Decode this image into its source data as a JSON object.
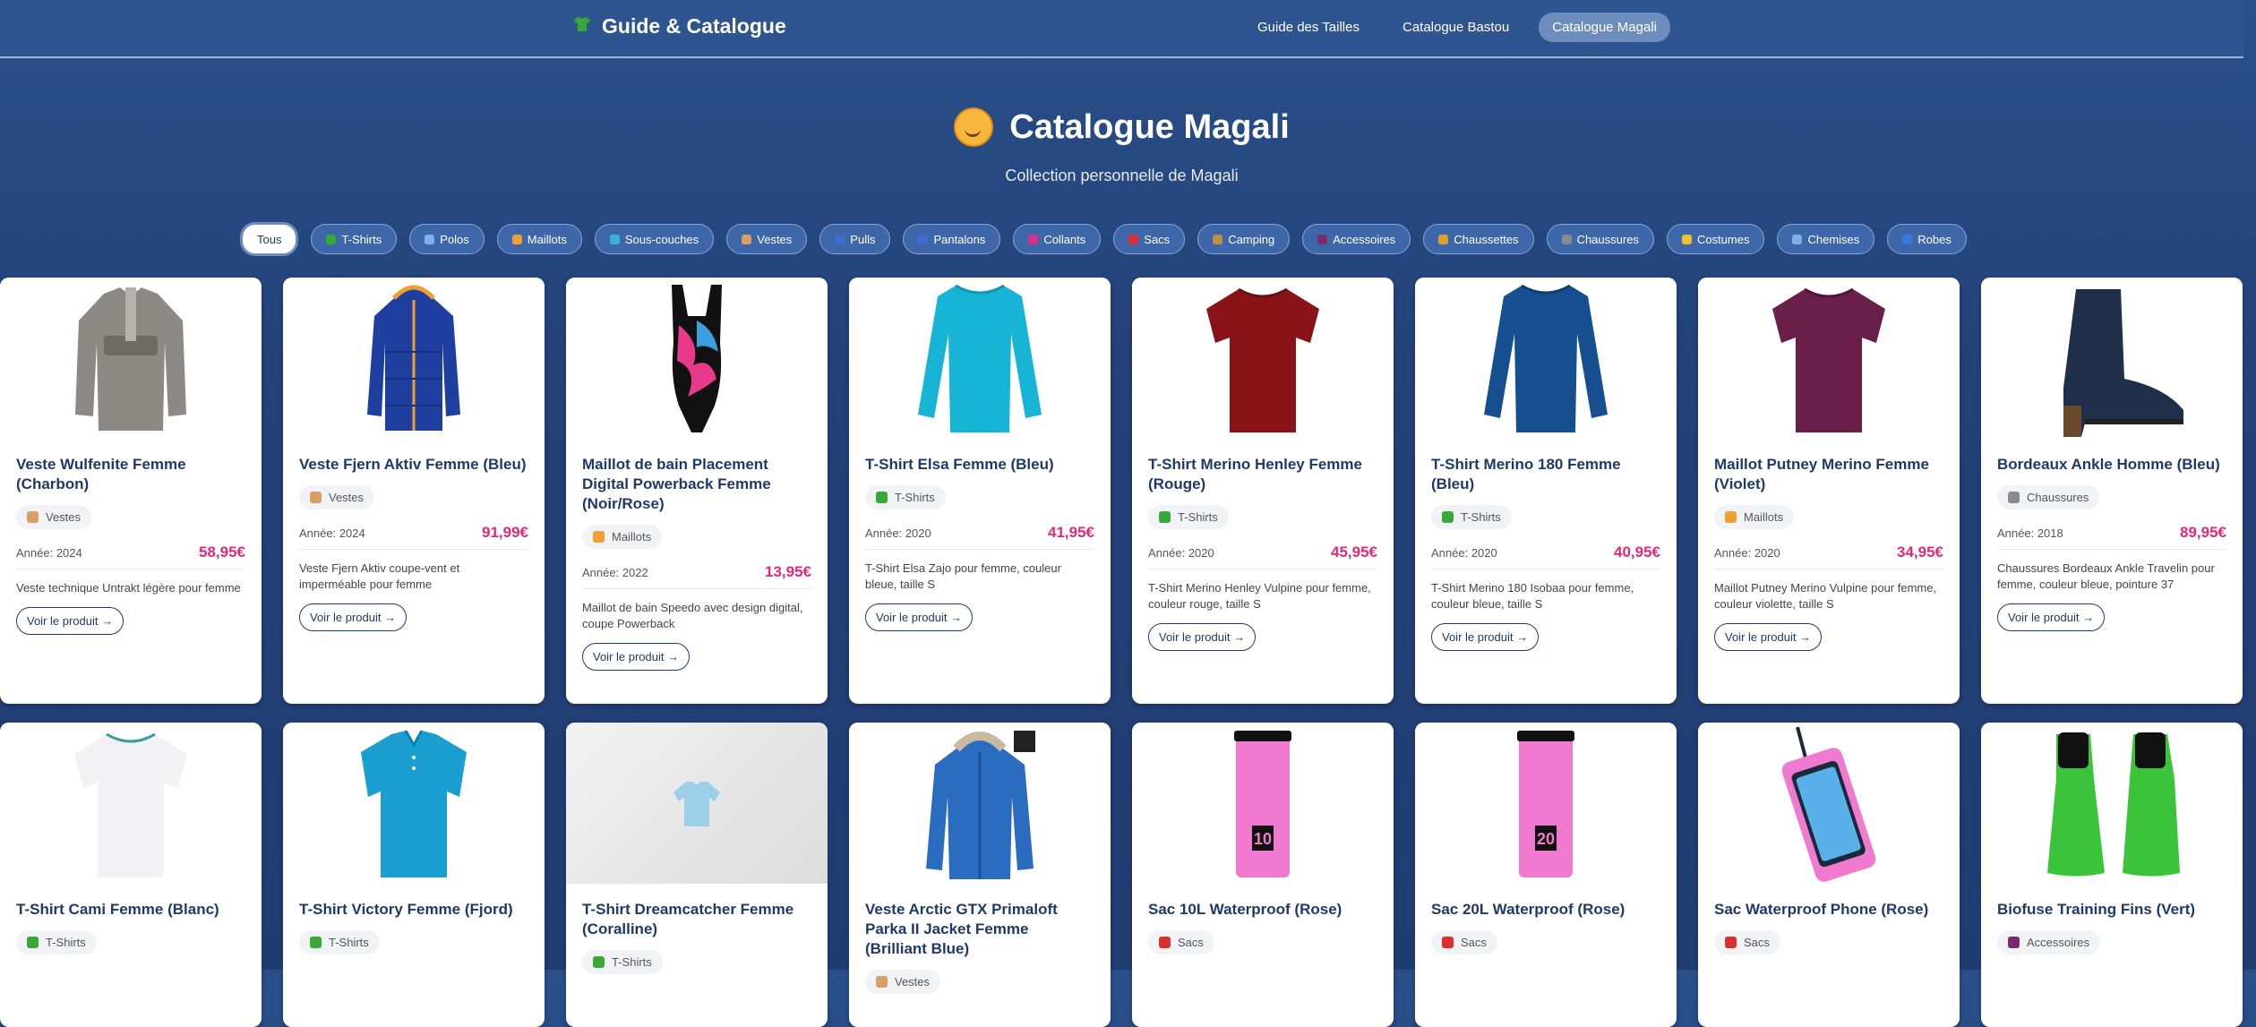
{
  "header": {
    "brand": "Guide & Catalogue",
    "nav": [
      {
        "label": "Guide des Tailles",
        "active": false
      },
      {
        "label": "Catalogue Bastou",
        "active": false
      },
      {
        "label": "Catalogue Magali",
        "active": true
      }
    ]
  },
  "hero": {
    "title": "Catalogue Magali",
    "subtitle": "Collection personnelle de Magali"
  },
  "filters": [
    {
      "label": "Tous",
      "color": ""
    },
    {
      "label": "T-Shirts",
      "color": "#38a838"
    },
    {
      "label": "Polos",
      "color": "#7fb0e8"
    },
    {
      "label": "Maillots",
      "color": "#f0a030"
    },
    {
      "label": "Sous-couches",
      "color": "#3fb0d8"
    },
    {
      "label": "Vestes",
      "color": "#d9a066"
    },
    {
      "label": "Pulls",
      "color": "#3a6fd0"
    },
    {
      "label": "Pantalons",
      "color": "#3a6fd0"
    },
    {
      "label": "Collants",
      "color": "#d8308a"
    },
    {
      "label": "Sacs",
      "color": "#d83030"
    },
    {
      "label": "Camping",
      "color": "#c09040"
    },
    {
      "label": "Accessoires",
      "color": "#7a2a6a"
    },
    {
      "label": "Chaussettes",
      "color": "#e0a030"
    },
    {
      "label": "Chaussures",
      "color": "#8a8a8a"
    },
    {
      "label": "Costumes",
      "color": "#f0c030"
    },
    {
      "label": "Chemises",
      "color": "#7fb0e8"
    },
    {
      "label": "Robes",
      "color": "#3a7ae0"
    }
  ],
  "cards": [
    {
      "title": "Veste Wulfenite Femme (Charbon)",
      "category": "Vestes",
      "cat_color": "#d9a066",
      "year": "Année: 2024",
      "price": "58,95€",
      "desc": "Veste technique Untrakt légère pour femme",
      "button": "Voir le produit →",
      "garment": "fleece",
      "color": "#8d8a85",
      "accent": "#6e6b66"
    },
    {
      "title": "Veste Fjern Aktiv Femme (Bleu)",
      "category": "Vestes",
      "cat_color": "#d9a066",
      "year": "Année: 2024",
      "price": "91,99€",
      "desc": "Veste Fjern Aktiv coupe-vent et imperméable pour femme",
      "button": "Voir le produit →",
      "garment": "jacket",
      "color": "#1f3fa0",
      "accent": "#f0a030"
    },
    {
      "title": "Maillot de bain Placement Digital Powerback Femme (Noir/Rose)",
      "category": "Maillots",
      "cat_color": "#f0a030",
      "year": "Année: 2022",
      "price": "13,95€",
      "desc": "Maillot de bain Speedo avec design digital, coupe Powerback",
      "button": "Voir le produit →",
      "garment": "swimsuit",
      "color": "#111111",
      "accent": "#e83a8a"
    },
    {
      "title": "T-Shirt Elsa Femme (Bleu)",
      "category": "T-Shirts",
      "cat_color": "#38a838",
      "year": "Année: 2020",
      "price": "41,95€",
      "desc": "T-Shirt Elsa Zajo pour femme, couleur bleue, taille S",
      "button": "Voir le produit →",
      "garment": "longsleeve",
      "color": "#17b4d6",
      "accent": "#0f96b8"
    },
    {
      "title": "T-Shirt Merino Henley Femme (Rouge)",
      "category": "T-Shirts",
      "cat_color": "#38a838",
      "year": "Année: 2020",
      "price": "45,95€",
      "desc": "T-Shirt Merino Henley Vulpine pour femme, couleur rouge, taille S",
      "button": "Voir le produit →",
      "garment": "tee",
      "color": "#8a1219",
      "accent": "#6a0c12"
    },
    {
      "title": "T-Shirt Merino 180 Femme (Bleu)",
      "category": "T-Shirts",
      "cat_color": "#38a838",
      "year": "Année: 2020",
      "price": "40,95€",
      "desc": "T-Shirt Merino 180 Isobaa pour femme, couleur bleue, taille S",
      "button": "Voir le produit →",
      "garment": "longsleeve",
      "color": "#154f8f",
      "accent": "#0e3d70"
    },
    {
      "title": "Maillot Putney Merino Femme (Violet)",
      "category": "Maillots",
      "cat_color": "#f0a030",
      "year": "Année: 2020",
      "price": "34,95€",
      "desc": "Maillot Putney Merino Vulpine pour femme, couleur violette, taille S",
      "button": "Voir le produit →",
      "garment": "tee",
      "color": "#6a1f4a",
      "accent": "#4e1436"
    },
    {
      "title": "Bordeaux Ankle Homme (Bleu)",
      "category": "Chaussures",
      "cat_color": "#8a8a8a",
      "year": "Année: 2018",
      "price": "89,95€",
      "desc": "Chaussures Bordeaux Ankle Travelin pour femme, couleur bleue, pointure 37",
      "button": "Voir le produit →",
      "garment": "boot",
      "color": "#1f2f4a",
      "accent": "#6a4a2a"
    },
    {
      "title": "T-Shirt Cami Femme (Blanc)",
      "category": "T-Shirts",
      "cat_color": "#38a838",
      "garment": "tee",
      "color": "#f2f2f4",
      "accent": "#3a9a9a"
    },
    {
      "title": "T-Shirt Victory Femme (Fjord)",
      "category": "T-Shirts",
      "cat_color": "#38a838",
      "garment": "polo",
      "color": "#1a9ed0",
      "accent": "#0d7fb0"
    },
    {
      "title": "T-Shirt Dreamcatcher Femme (Coralline)",
      "category": "T-Shirts",
      "cat_color": "#38a838",
      "garment": "placeholder",
      "color": "#9ccfe8",
      "accent": "#7fbddc"
    },
    {
      "title": "Veste Arctic GTX Primaloft Parka II Jacket Femme (Brilliant Blue)",
      "category": "Vestes",
      "cat_color": "#d9a066",
      "garment": "parka",
      "color": "#2a6cc0",
      "accent": "#1c4f95"
    },
    {
      "title": "Sac 10L Waterproof (Rose)",
      "category": "Sacs",
      "cat_color": "#d83030",
      "garment": "drybag",
      "color": "#f07ad0",
      "accent": "#111111",
      "bag_label": "10"
    },
    {
      "title": "Sac 20L Waterproof (Rose)",
      "category": "Sacs",
      "cat_color": "#d83030",
      "garment": "drybag",
      "color": "#f07ad0",
      "accent": "#111111",
      "bag_label": "20"
    },
    {
      "title": "Sac Waterproof Phone (Rose)",
      "category": "Sacs",
      "cat_color": "#d83030",
      "garment": "phonebag",
      "color": "#f07ad0",
      "accent": "#1b2a3a"
    },
    {
      "title": "Biofuse Training Fins (Vert)",
      "category": "Accessoires",
      "cat_color": "#7a2a6a",
      "garment": "fins",
      "color": "#3bc43b",
      "accent": "#111111"
    }
  ]
}
